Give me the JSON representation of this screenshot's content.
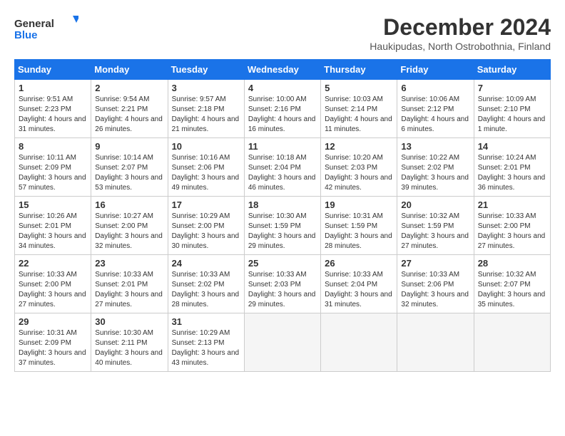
{
  "logo": {
    "line1": "General",
    "line2": "Blue"
  },
  "title": "December 2024",
  "location": "Haukipudas, North Ostrobothnia, Finland",
  "days_of_week": [
    "Sunday",
    "Monday",
    "Tuesday",
    "Wednesday",
    "Thursday",
    "Friday",
    "Saturday"
  ],
  "weeks": [
    [
      {
        "day": "1",
        "sunrise": "9:51 AM",
        "sunset": "2:23 PM",
        "daylight": "4 hours and 31 minutes."
      },
      {
        "day": "2",
        "sunrise": "9:54 AM",
        "sunset": "2:21 PM",
        "daylight": "4 hours and 26 minutes."
      },
      {
        "day": "3",
        "sunrise": "9:57 AM",
        "sunset": "2:18 PM",
        "daylight": "4 hours and 21 minutes."
      },
      {
        "day": "4",
        "sunrise": "10:00 AM",
        "sunset": "2:16 PM",
        "daylight": "4 hours and 16 minutes."
      },
      {
        "day": "5",
        "sunrise": "10:03 AM",
        "sunset": "2:14 PM",
        "daylight": "4 hours and 11 minutes."
      },
      {
        "day": "6",
        "sunrise": "10:06 AM",
        "sunset": "2:12 PM",
        "daylight": "4 hours and 6 minutes."
      },
      {
        "day": "7",
        "sunrise": "10:09 AM",
        "sunset": "2:10 PM",
        "daylight": "4 hours and 1 minute."
      }
    ],
    [
      {
        "day": "8",
        "sunrise": "10:11 AM",
        "sunset": "2:09 PM",
        "daylight": "3 hours and 57 minutes."
      },
      {
        "day": "9",
        "sunrise": "10:14 AM",
        "sunset": "2:07 PM",
        "daylight": "3 hours and 53 minutes."
      },
      {
        "day": "10",
        "sunrise": "10:16 AM",
        "sunset": "2:06 PM",
        "daylight": "3 hours and 49 minutes."
      },
      {
        "day": "11",
        "sunrise": "10:18 AM",
        "sunset": "2:04 PM",
        "daylight": "3 hours and 46 minutes."
      },
      {
        "day": "12",
        "sunrise": "10:20 AM",
        "sunset": "2:03 PM",
        "daylight": "3 hours and 42 minutes."
      },
      {
        "day": "13",
        "sunrise": "10:22 AM",
        "sunset": "2:02 PM",
        "daylight": "3 hours and 39 minutes."
      },
      {
        "day": "14",
        "sunrise": "10:24 AM",
        "sunset": "2:01 PM",
        "daylight": "3 hours and 36 minutes."
      }
    ],
    [
      {
        "day": "15",
        "sunrise": "10:26 AM",
        "sunset": "2:01 PM",
        "daylight": "3 hours and 34 minutes."
      },
      {
        "day": "16",
        "sunrise": "10:27 AM",
        "sunset": "2:00 PM",
        "daylight": "3 hours and 32 minutes."
      },
      {
        "day": "17",
        "sunrise": "10:29 AM",
        "sunset": "2:00 PM",
        "daylight": "3 hours and 30 minutes."
      },
      {
        "day": "18",
        "sunrise": "10:30 AM",
        "sunset": "1:59 PM",
        "daylight": "3 hours and 29 minutes."
      },
      {
        "day": "19",
        "sunrise": "10:31 AM",
        "sunset": "1:59 PM",
        "daylight": "3 hours and 28 minutes."
      },
      {
        "day": "20",
        "sunrise": "10:32 AM",
        "sunset": "1:59 PM",
        "daylight": "3 hours and 27 minutes."
      },
      {
        "day": "21",
        "sunrise": "10:33 AM",
        "sunset": "2:00 PM",
        "daylight": "3 hours and 27 minutes."
      }
    ],
    [
      {
        "day": "22",
        "sunrise": "10:33 AM",
        "sunset": "2:00 PM",
        "daylight": "3 hours and 27 minutes."
      },
      {
        "day": "23",
        "sunrise": "10:33 AM",
        "sunset": "2:01 PM",
        "daylight": "3 hours and 27 minutes."
      },
      {
        "day": "24",
        "sunrise": "10:33 AM",
        "sunset": "2:02 PM",
        "daylight": "3 hours and 28 minutes."
      },
      {
        "day": "25",
        "sunrise": "10:33 AM",
        "sunset": "2:03 PM",
        "daylight": "3 hours and 29 minutes."
      },
      {
        "day": "26",
        "sunrise": "10:33 AM",
        "sunset": "2:04 PM",
        "daylight": "3 hours and 31 minutes."
      },
      {
        "day": "27",
        "sunrise": "10:33 AM",
        "sunset": "2:06 PM",
        "daylight": "3 hours and 32 minutes."
      },
      {
        "day": "28",
        "sunrise": "10:32 AM",
        "sunset": "2:07 PM",
        "daylight": "3 hours and 35 minutes."
      }
    ],
    [
      {
        "day": "29",
        "sunrise": "10:31 AM",
        "sunset": "2:09 PM",
        "daylight": "3 hours and 37 minutes."
      },
      {
        "day": "30",
        "sunrise": "10:30 AM",
        "sunset": "2:11 PM",
        "daylight": "3 hours and 40 minutes."
      },
      {
        "day": "31",
        "sunrise": "10:29 AM",
        "sunset": "2:13 PM",
        "daylight": "3 hours and 43 minutes."
      },
      null,
      null,
      null,
      null
    ]
  ]
}
